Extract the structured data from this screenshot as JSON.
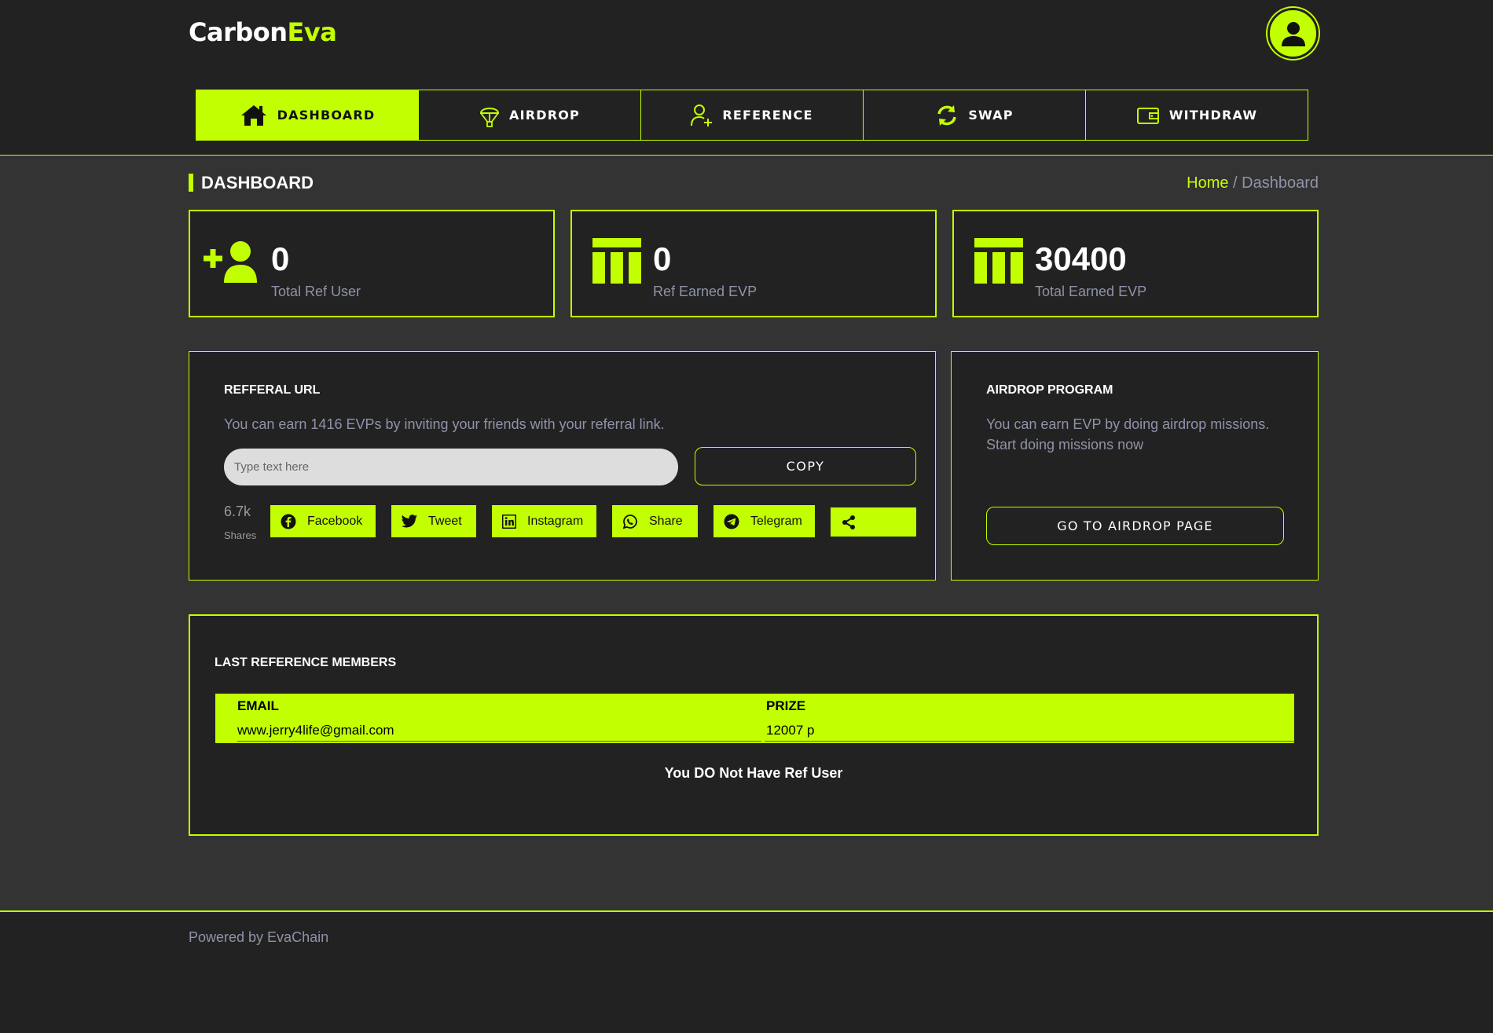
{
  "brand": {
    "name_part1": "Carbon",
    "name_part2": "Eva"
  },
  "colors": {
    "accent": "#c2ff00",
    "background": "#333333",
    "panel": "#222222",
    "muted_text": "#8f93a8"
  },
  "nav": {
    "items": [
      {
        "label": "DASHBOARD",
        "icon": "home-icon",
        "active": true
      },
      {
        "label": "AIRDROP",
        "icon": "parachute-icon",
        "active": false
      },
      {
        "label": "REFERENCE",
        "icon": "user-plus-icon",
        "active": false
      },
      {
        "label": "SWAP",
        "icon": "swap-arrows-icon",
        "active": false
      },
      {
        "label": "WITHDRAW",
        "icon": "wallet-icon",
        "active": false
      }
    ]
  },
  "page": {
    "title": "DASHBOARD",
    "breadcrumb": {
      "home": "Home",
      "separator": " / ",
      "current": "Dashboard"
    }
  },
  "stats": [
    {
      "value": "0",
      "label": "Total Ref User",
      "icon": "user-plus-icon"
    },
    {
      "value": "0",
      "label": "Ref Earned EVP",
      "icon": "table-icon"
    },
    {
      "value": "30400",
      "label": "Total Earned EVP",
      "icon": "table-icon"
    }
  ],
  "referral": {
    "title": "REFFERAL URL",
    "description": "You can earn 1416 EVPs by inviting your friends with your referral link.",
    "input_placeholder": "Type text here",
    "input_value": "",
    "copy_label": "COPY",
    "shares_count": "6.7k",
    "shares_label": "Shares",
    "share_buttons": [
      {
        "label": "Facebook",
        "icon": "facebook-icon"
      },
      {
        "label": "Tweet",
        "icon": "twitter-icon"
      },
      {
        "label": "Instagram",
        "icon": "linkedin-icon"
      },
      {
        "label": "Share",
        "icon": "whatsapp-icon"
      },
      {
        "label": "Telegram",
        "icon": "telegram-icon"
      },
      {
        "label": "",
        "icon": "share-icon"
      }
    ]
  },
  "airdrop": {
    "title": "AIRDROP PROGRAM",
    "line1": "You can earn EVP by doing airdrop missions.",
    "line2": "Start doing missions now",
    "button_label": "GO TO AIRDROP PAGE"
  },
  "members": {
    "title": "LAST REFERENCE MEMBERS",
    "columns": [
      "EMAIL",
      "PRIZE"
    ],
    "rows": [
      {
        "email": "www.jerry4life@gmail.com",
        "prize": "12007 p"
      }
    ],
    "empty_note": "You DO Not Have Ref User"
  },
  "footer": {
    "text": "Powered by EvaChain"
  }
}
